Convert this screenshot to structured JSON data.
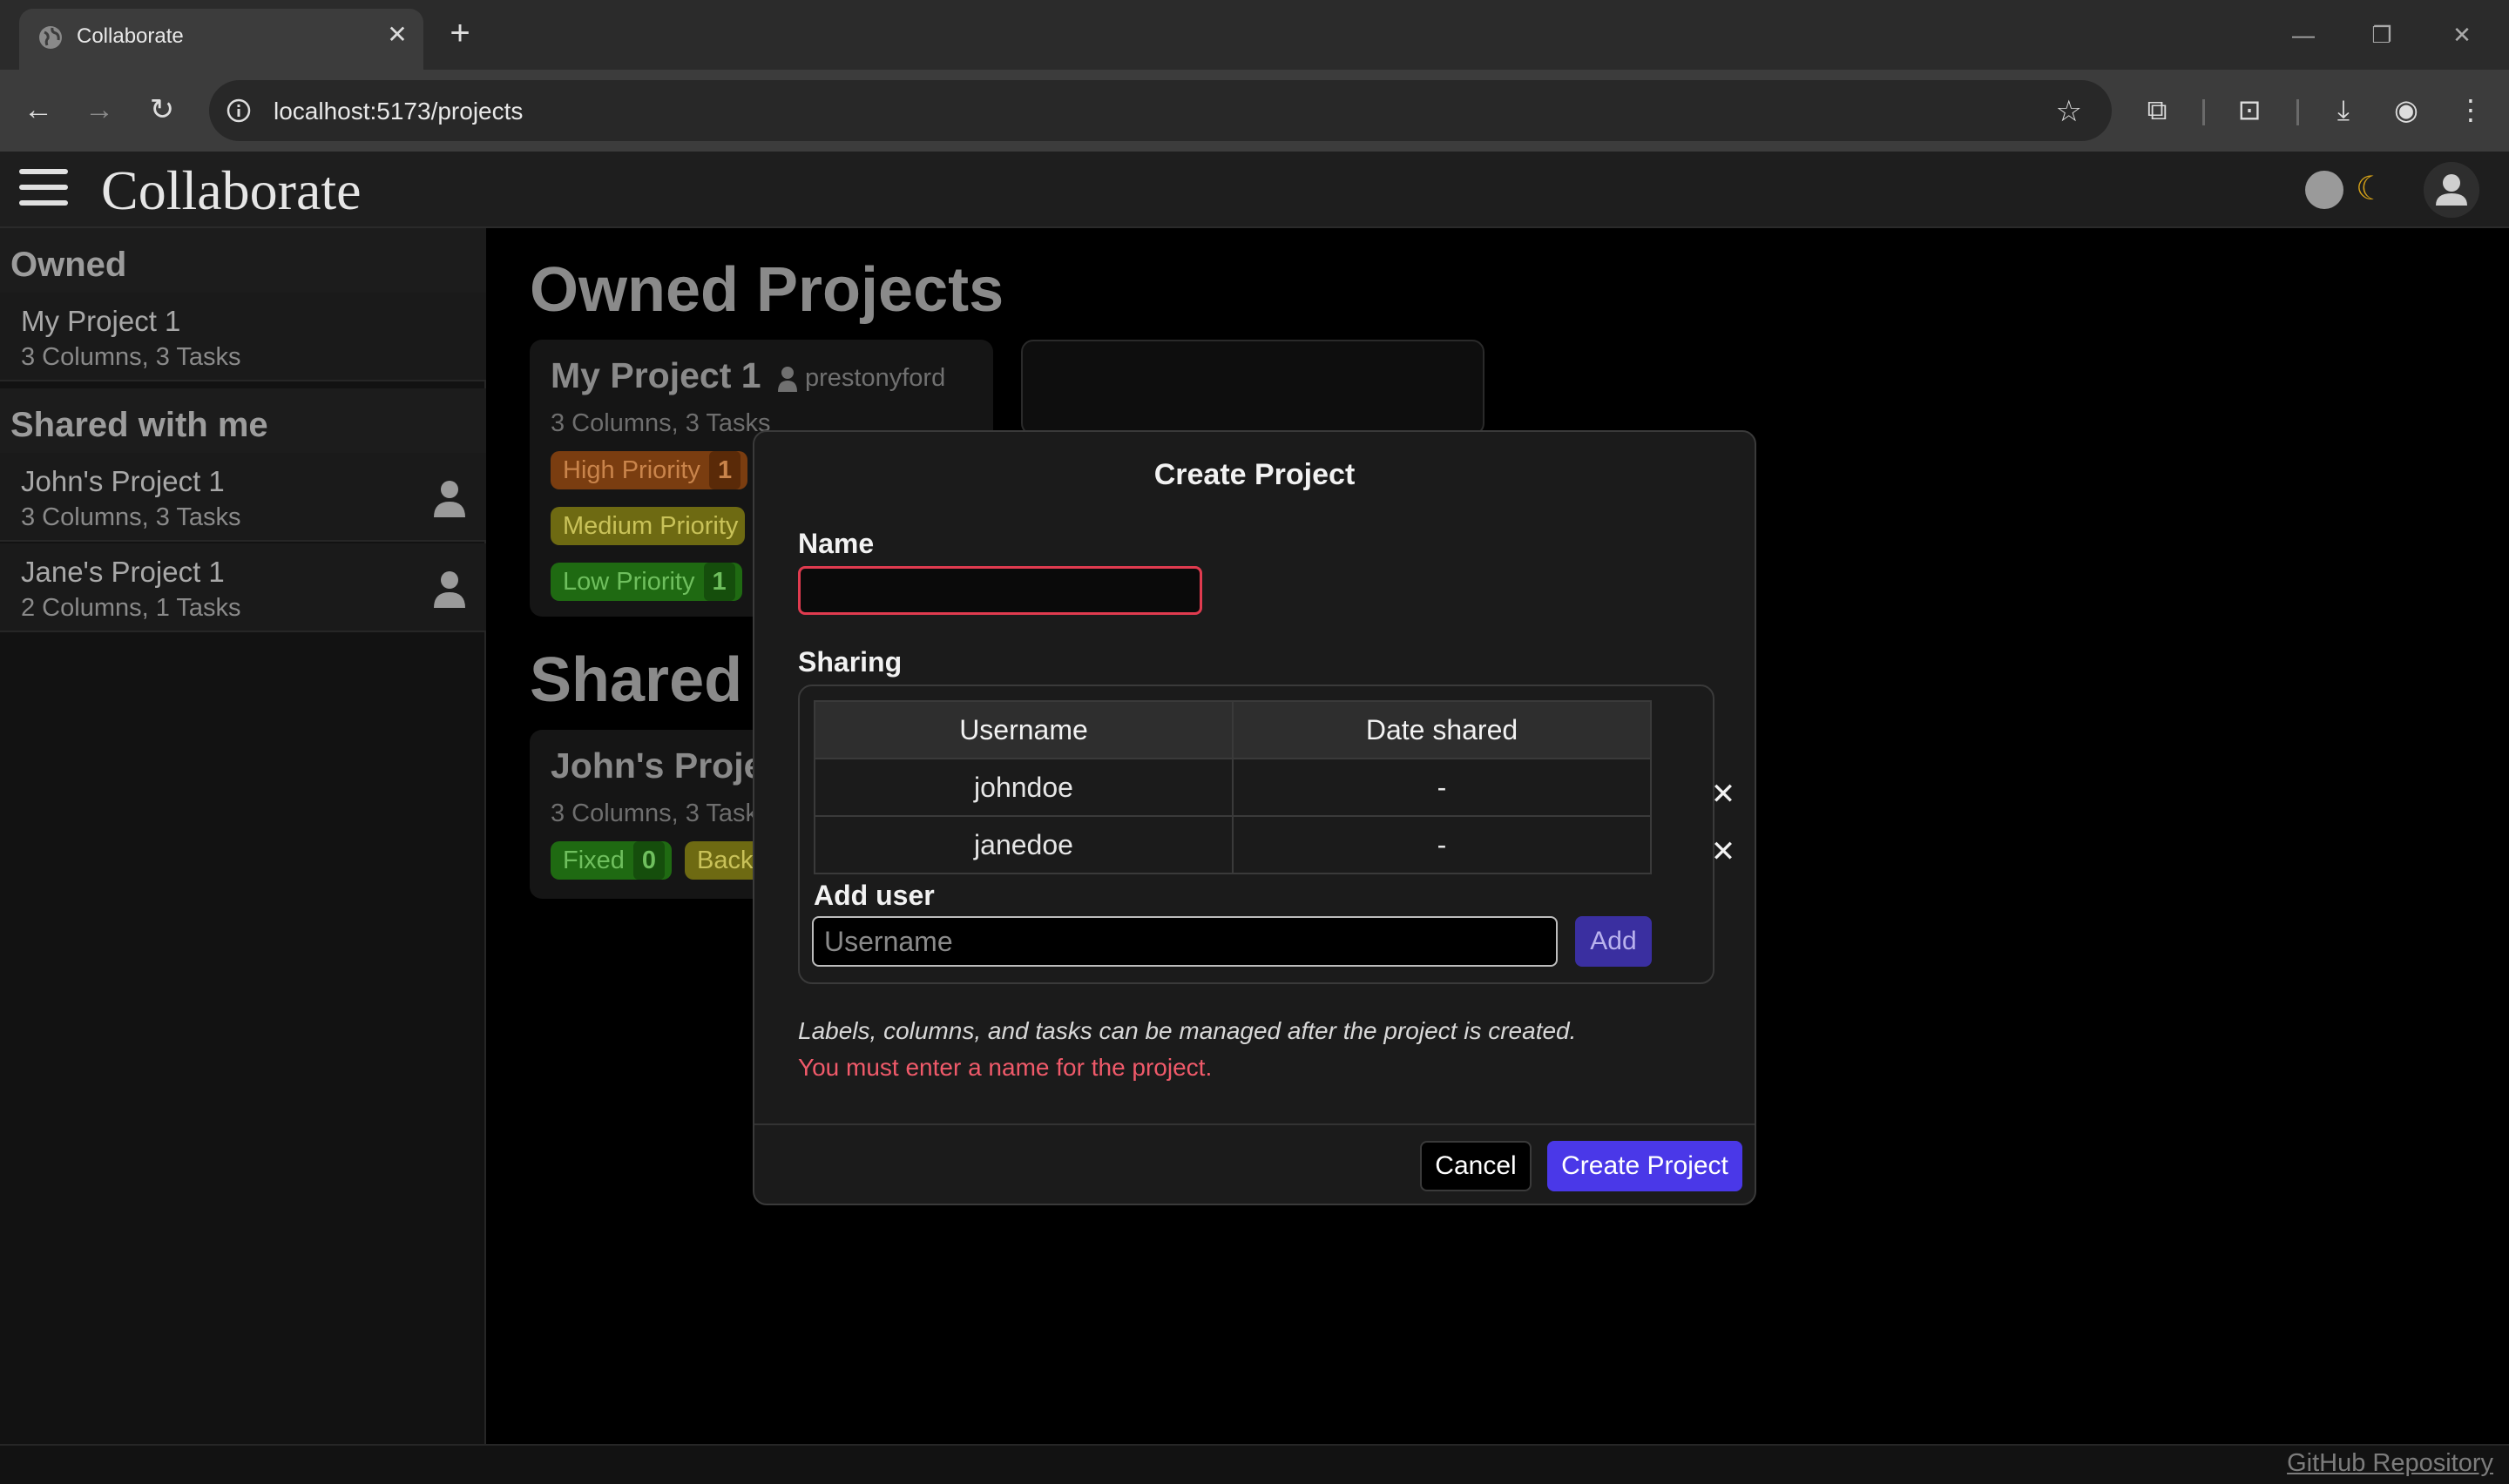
{
  "browser": {
    "tab_title": "Collaborate",
    "url": "localhost:5173/projects"
  },
  "app": {
    "title": "Collaborate"
  },
  "sidebar": {
    "owned_heading": "Owned",
    "owned": [
      {
        "name": "My Project 1",
        "meta": "3 Columns, 3 Tasks"
      }
    ],
    "shared_heading": "Shared with me",
    "shared": [
      {
        "name": "John's Project 1",
        "meta": "3 Columns, 3 Tasks"
      },
      {
        "name": "Jane's Project 1",
        "meta": "2 Columns, 1 Tasks"
      }
    ]
  },
  "main": {
    "owned_heading": "Owned Projects",
    "shared_heading": "Shared",
    "owned_cards": [
      {
        "name": "My Project 1",
        "owner": "prestonyford",
        "meta": "3 Columns, 3 Tasks",
        "labels": [
          {
            "text": "High Priority",
            "count": "1",
            "bg": "#7a3d10",
            "fg": "#c9844b",
            "cnt_bg": "#5a2a08"
          },
          {
            "text": "Medium Priority",
            "count": "",
            "bg": "#6e6a12",
            "fg": "#c9c259",
            "cnt_bg": "#55520c"
          },
          {
            "text": "Low Priority",
            "count": "1",
            "bg": "#1f6a12",
            "fg": "#6fbf5e",
            "cnt_bg": "#154e0c"
          }
        ]
      }
    ],
    "shared_cards": [
      {
        "name": "John's Project 1",
        "meta": "3 Columns, 3 Tasks",
        "labels": [
          {
            "text": "Fixed",
            "count": "0",
            "bg": "#1f6a12",
            "fg": "#6fbf5e",
            "cnt_bg": "#154e0c"
          },
          {
            "text": "Backlog",
            "count": "",
            "bg": "#6e6a12",
            "fg": "#c9c259",
            "cnt_bg": "#55520c"
          }
        ]
      }
    ]
  },
  "modal": {
    "title": "Create Project",
    "name_label": "Name",
    "name_value": "",
    "sharing_label": "Sharing",
    "table_headers": [
      "Username",
      "Date shared"
    ],
    "shared_users": [
      {
        "username": "johndoe",
        "date_shared": "-"
      },
      {
        "username": "janedoe",
        "date_shared": "-"
      }
    ],
    "add_user_label": "Add user",
    "add_user_placeholder": "Username",
    "add_button": "Add",
    "hint": "Labels, columns, and tasks can be managed after the project is created.",
    "error": "You must enter a name for the project.",
    "cancel_button": "Cancel",
    "create_button": "Create Project"
  },
  "footer": {
    "github_link": "GitHub Repository"
  }
}
